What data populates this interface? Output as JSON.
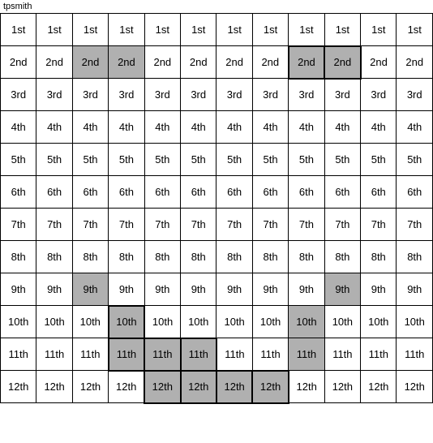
{
  "title": "tpsmith",
  "rows": [
    {
      "label": "1st",
      "highlights": [
        false,
        false,
        false,
        false,
        false,
        false,
        false,
        false,
        false,
        false,
        false,
        false
      ]
    },
    {
      "label": "2nd",
      "highlights": [
        false,
        false,
        true,
        true,
        false,
        false,
        false,
        false,
        true,
        true,
        false,
        false
      ]
    },
    {
      "label": "3rd",
      "highlights": [
        false,
        false,
        false,
        false,
        false,
        false,
        false,
        false,
        false,
        false,
        false,
        false
      ]
    },
    {
      "label": "4th",
      "highlights": [
        false,
        false,
        false,
        false,
        false,
        false,
        false,
        false,
        false,
        false,
        false,
        false
      ]
    },
    {
      "label": "5th",
      "highlights": [
        false,
        false,
        false,
        false,
        false,
        false,
        false,
        false,
        false,
        false,
        false,
        false
      ]
    },
    {
      "label": "6th",
      "highlights": [
        false,
        false,
        false,
        false,
        false,
        false,
        false,
        false,
        false,
        false,
        false,
        false
      ]
    },
    {
      "label": "7th",
      "highlights": [
        false,
        false,
        false,
        false,
        false,
        false,
        false,
        false,
        false,
        false,
        false,
        false
      ]
    },
    {
      "label": "8th",
      "highlights": [
        false,
        false,
        false,
        false,
        false,
        false,
        false,
        false,
        false,
        false,
        false,
        false
      ]
    },
    {
      "label": "9th",
      "highlights": [
        false,
        false,
        true,
        false,
        false,
        false,
        false,
        false,
        false,
        true,
        false,
        false
      ]
    },
    {
      "label": "10th",
      "highlights": [
        false,
        false,
        false,
        true,
        false,
        false,
        false,
        false,
        true,
        false,
        false,
        false
      ]
    },
    {
      "label": "11th",
      "highlights": [
        false,
        false,
        false,
        true,
        true,
        true,
        false,
        false,
        true,
        false,
        false,
        false
      ]
    },
    {
      "label": "12th",
      "highlights": [
        false,
        false,
        false,
        false,
        true,
        true,
        true,
        true,
        false,
        false,
        false,
        false
      ]
    }
  ],
  "cols": 12
}
